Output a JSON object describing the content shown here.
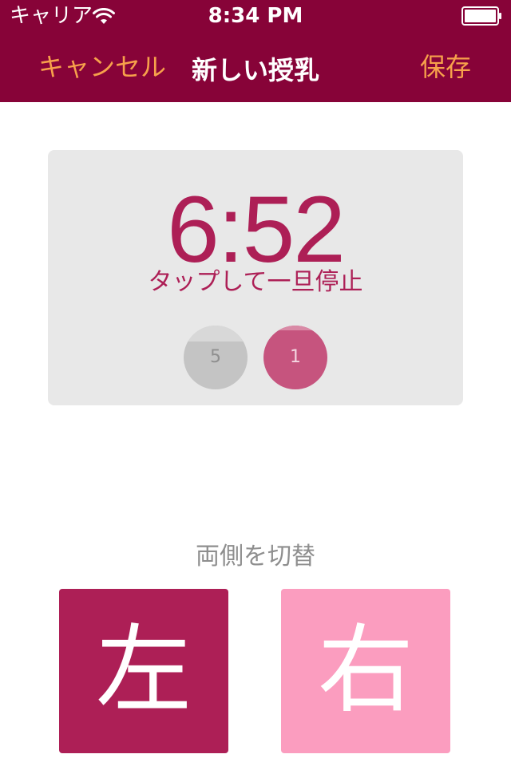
{
  "status_bar": {
    "carrier": "キャリア",
    "time": "8:34 PM",
    "wifi_icon": "wifi-icon",
    "battery_icon": "battery-icon"
  },
  "nav": {
    "cancel_label": "キャンセル",
    "title": "新しい授乳",
    "save_label": "保存"
  },
  "timer": {
    "value": "6:52",
    "hint": "タップして一旦停止",
    "left_count": "5",
    "right_count": "1"
  },
  "switch": {
    "label": "両側を切替",
    "left_label": "左",
    "right_label": "右"
  },
  "colors": {
    "bar_background": "#870338",
    "nav_button_text": "#f7a14b",
    "timer_text": "#ad1f56",
    "card_background": "#e8e8e8",
    "left_button": "#ad1f56",
    "right_button": "#fb9dbf",
    "left_counter": "#c4c4c4",
    "right_counter": "#c6547e"
  }
}
